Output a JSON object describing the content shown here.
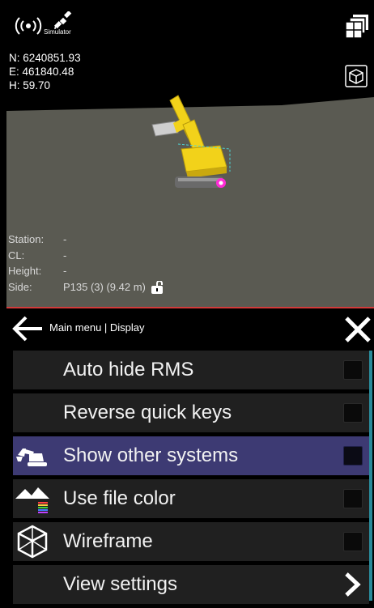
{
  "status": {
    "signal_icon": "broadcast-signal-icon",
    "satellite_icon": "satellite-icon",
    "simulator_label": "Simulator",
    "layers_icon": "layers-icon",
    "view_cube_icon": "view-cube-icon"
  },
  "coords": {
    "north": "N: 6240851.93",
    "east": "E: 461840.48",
    "height": "H: 59.70"
  },
  "info": {
    "station_key": "Station:",
    "station_val": "-",
    "cl_key": "CL:",
    "cl_val": "-",
    "height_key": "Height:",
    "height_val": "-",
    "side_key": "Side:",
    "side_val": "P135 (3) (9.42 m)"
  },
  "menu": {
    "title": "Main menu | Display",
    "items": [
      {
        "label": "Auto hide RMS",
        "icon": "",
        "control": "checkbox",
        "checked": false,
        "selected": false
      },
      {
        "label": "Reverse quick keys",
        "icon": "",
        "control": "checkbox",
        "checked": false,
        "selected": false
      },
      {
        "label": "Show other systems",
        "icon": "excavator-icon",
        "control": "checkbox",
        "checked": false,
        "selected": true
      },
      {
        "label": "Use file color",
        "icon": "terrain-color-icon",
        "control": "checkbox",
        "checked": false,
        "selected": false
      },
      {
        "label": "Wireframe",
        "icon": "wireframe-cube-icon",
        "control": "checkbox",
        "checked": false,
        "selected": false
      },
      {
        "label": "View settings",
        "icon": "",
        "control": "chevron",
        "selected": false
      }
    ]
  },
  "colors": {
    "ground": "#5a5a52",
    "divider": "#d33a3a",
    "selected_row": "#3d3a73",
    "row": "#202020",
    "scrollbar": "#2a8a9a",
    "machine_yellow": "#f2d21a",
    "target_magenta": "#ff2bd6"
  }
}
